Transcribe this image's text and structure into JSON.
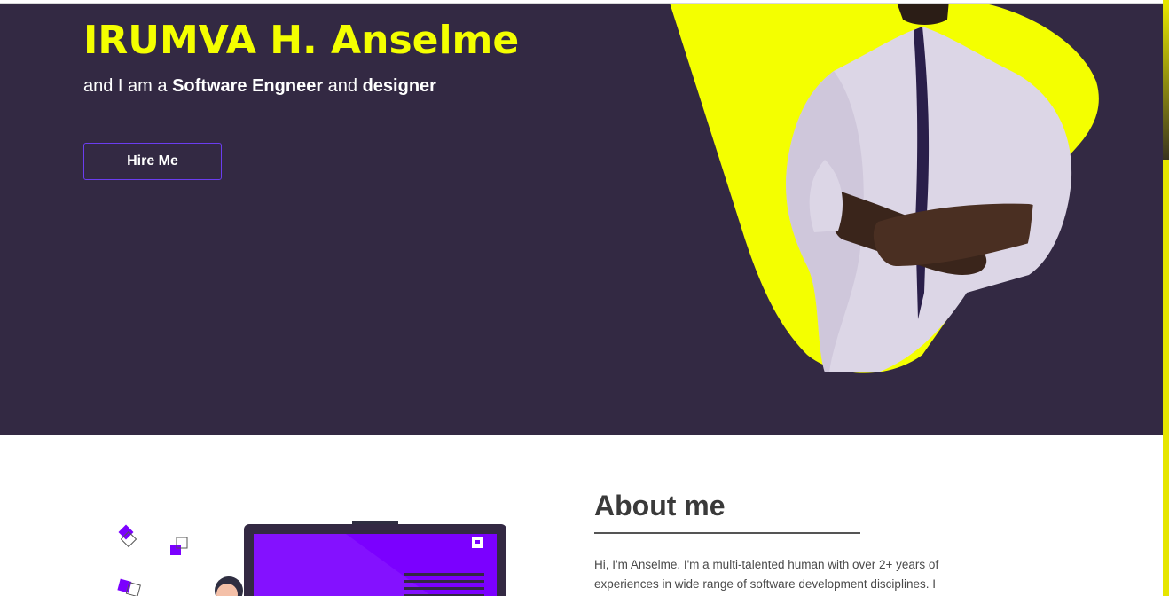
{
  "hero": {
    "name": "IRUMVA H. Anselme",
    "sub_prefix": "and I am a ",
    "sub_role1": "Software Engneer",
    "sub_mid": " and ",
    "sub_role2": "designer",
    "hire_label": "Hire Me"
  },
  "about": {
    "title": "About me",
    "line1": "Hi, I'm Anselme. I'm a multi-talented human with over 2+ years of",
    "line2": "experiences in wide range of software development disciplines. I"
  },
  "colors": {
    "hero_bg": "#332943",
    "accent_yellow": "#f4ff00",
    "accent_purple": "#7b00ff",
    "button_border": "#6b3df0"
  },
  "icons": [
    "portrait-photo",
    "developer-illustration"
  ]
}
